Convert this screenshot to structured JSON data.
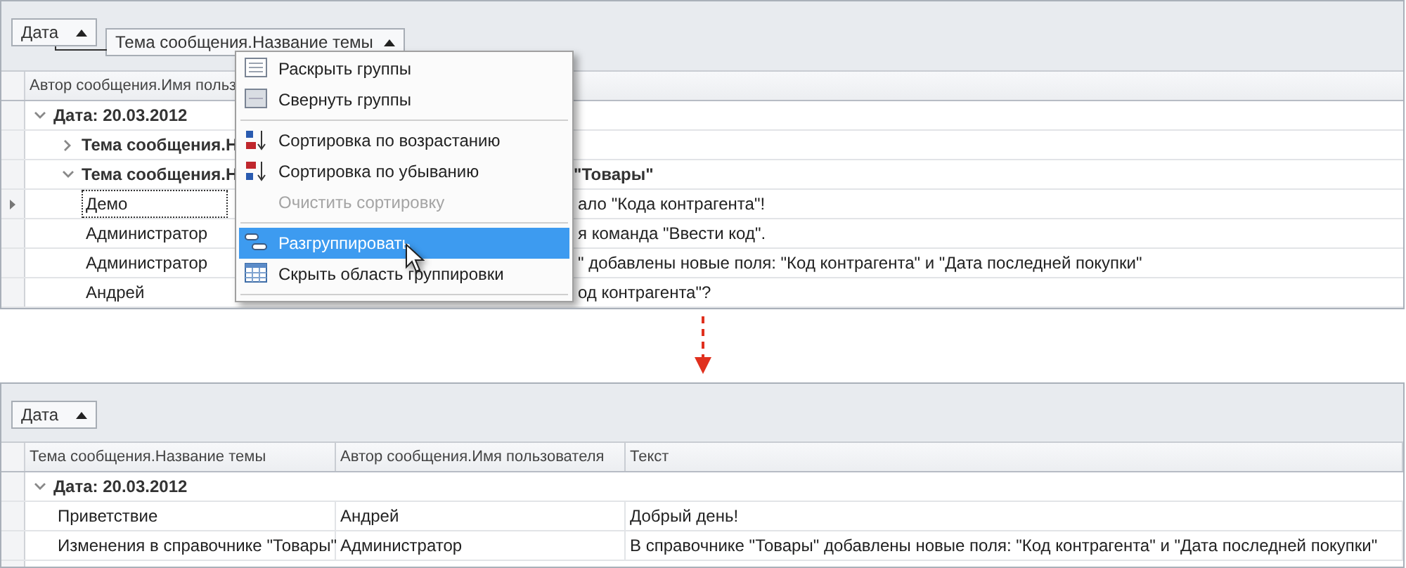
{
  "before": {
    "group_panel": [
      {
        "label": "Дата"
      },
      {
        "label": "Тема сообщения.Название темы"
      }
    ],
    "columns": [
      {
        "label": "Автор сообщения.Имя польз"
      }
    ],
    "rows": [
      {
        "kind": "group",
        "text": "Дата: 20.03.2012",
        "expanded": true,
        "children": [
          {
            "kind": "group",
            "text": "Тема сообщения.Н",
            "expanded": false
          },
          {
            "kind": "group",
            "text": "Тема сообщения.Н",
            "tail": "\"Товары\"",
            "expanded": true,
            "children": [
              {
                "kind": "record",
                "author": "Демо",
                "text": "ало \"Кода контрагента\"!",
                "current": true
              },
              {
                "kind": "record",
                "author": "Администратор",
                "text": "я команда \"Ввести код\".",
                "current": false
              },
              {
                "kind": "record",
                "author": "Администратор",
                "text": "\" добавлены новые поля: \"Код контрагента\" и \"Дата последней покупки\"",
                "current": false
              },
              {
                "kind": "record",
                "author": "Андрей",
                "text": "од контрагента\"?",
                "current": false
              }
            ]
          }
        ]
      }
    ],
    "context_menu": [
      {
        "kind": "item",
        "label": "Раскрыть группы",
        "disabled": false,
        "selected": false
      },
      {
        "kind": "item",
        "label": "Свернуть группы",
        "disabled": false,
        "selected": false
      },
      {
        "kind": "separator"
      },
      {
        "kind": "item",
        "label": "Сортировка по возрастанию",
        "disabled": false,
        "selected": false
      },
      {
        "kind": "item",
        "label": "Сортировка по убыванию",
        "disabled": false,
        "selected": false
      },
      {
        "kind": "item",
        "label": "Очистить сортировку",
        "disabled": true,
        "selected": false
      },
      {
        "kind": "separator"
      },
      {
        "kind": "item",
        "label": "Разгруппировать",
        "disabled": false,
        "selected": true
      },
      {
        "kind": "item",
        "label": "Скрыть область группировки",
        "disabled": false,
        "selected": false
      },
      {
        "kind": "separator"
      }
    ]
  },
  "after": {
    "group_panel": [
      {
        "label": "Дата"
      }
    ],
    "columns": [
      {
        "label": "Тема сообщения.Название темы"
      },
      {
        "label": "Автор сообщения.Имя пользователя"
      },
      {
        "label": "Текст"
      }
    ],
    "rows": [
      {
        "kind": "group",
        "text": "Дата: 20.03.2012",
        "expanded": true,
        "children": [
          {
            "kind": "record",
            "cells": [
              "Приветствие",
              "Андрей",
              "Добрый день!"
            ],
            "current": false
          },
          {
            "kind": "record",
            "cells": [
              "Изменения в справочнике \"Товары\"",
              "Администратор",
              "В справочнике \"Товары\" добавлены новые поля: \"Код контрагента\" и \"Дата последней покупки\""
            ],
            "current": false
          }
        ]
      }
    ]
  }
}
